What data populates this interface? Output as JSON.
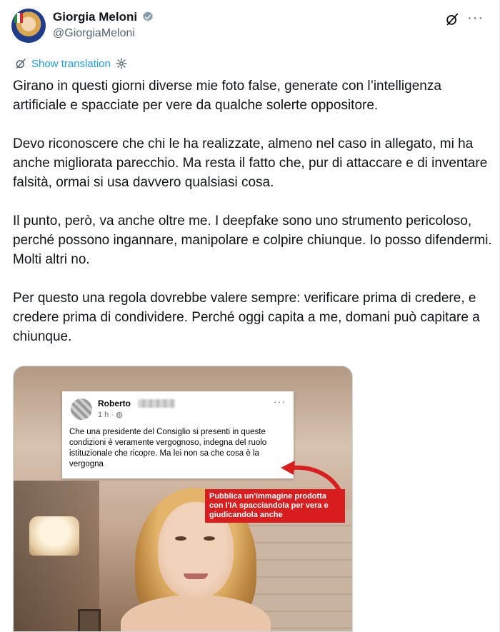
{
  "header": {
    "display_name": "Giorgia Meloni",
    "handle": "@GiorgiaMeloni"
  },
  "actions": {
    "translate_label": "Show translation"
  },
  "post": {
    "paragraphs": [
      "Girano in questi giorni diverse mie foto false, generate con l’intelligenza artificiale e spacciate per vere da qualche solerte oppositore.",
      "Devo riconoscere che chi le ha realizzate, almeno nel caso in allegato, mi ha anche migliorata parecchio. Ma resta il fatto che, pur di attaccare e di inventare falsità, ormai si usa davvero qualsiasi cosa.",
      "Il punto, però, va anche oltre me. I deepfake sono uno strumento pericoloso, perché possono ingannare, manipolare e colpire chiunque. Io posso difendermi. Molti altri no.",
      "Per questo una regola dovrebbe valere sempre: verificare prima di credere, e credere prima di condividere. Perché oggi capita a me, domani può capitare a chiunque."
    ]
  },
  "media": {
    "fb_post": {
      "author": "Roberto",
      "time": "1 h ·",
      "text": "Che una presidente del Consiglio  si presenti in queste condizioni è veramente vergognoso, indegna del ruolo istituzionale che ricopre. Ma lei non sa che cosa è la vergogna"
    },
    "annotation": "Pubblica un'immagine prodotta con l'IA spacciandola per vera e giudicandola anche"
  },
  "colors": {
    "accent": "#1d9bf0",
    "verified": "#829aab",
    "annotation_red": "#d81e1e"
  },
  "icons": [
    "verified-badge-icon",
    "grok-icon",
    "more-icon",
    "translate-icon",
    "settings-icon"
  ]
}
